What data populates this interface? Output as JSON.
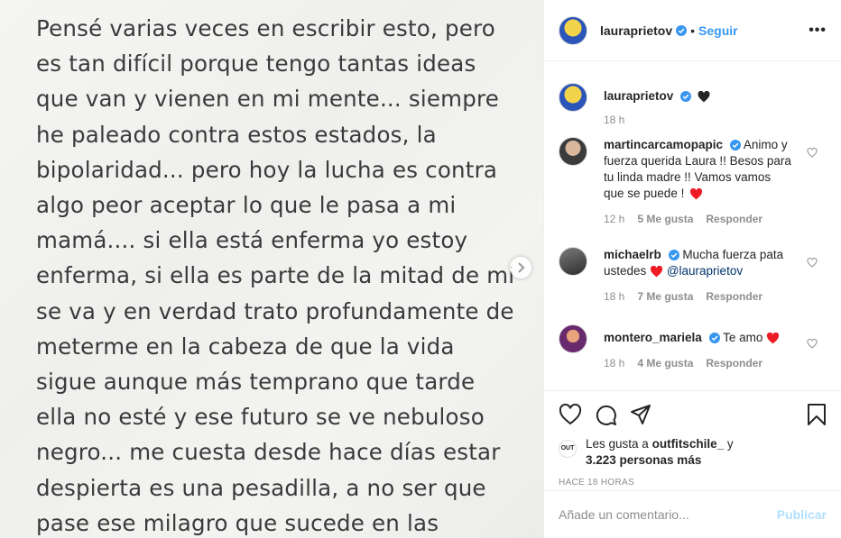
{
  "post_image": {
    "text": "Pensé varias veces en escribir esto, pero\nes tan difícil porque tengo tantas ideas\nque van y vienen en mi mente... siempre\nhe paleado contra estos estados, la\nbipolaridad... pero hoy la lucha es contra\nalgo peor aceptar lo que le pasa a mi\nmamá.... si ella está enferma yo estoy\nenferma, si ella es parte de la mitad de mi\nse va y en verdad trato profundamente de\nmeterme en la cabeza de que la vida\nsigue aunque más temprano que tarde\nella no esté y ese futuro se ve nebuloso\nnegro... me cuesta desde hace días estar\ndespierta es una pesadilla, a no ser que\npase ese milagro que sucede en las"
  },
  "header": {
    "username": "lauraprietov",
    "separator": "•",
    "follow_label": "Seguir",
    "more_label": "•••"
  },
  "caption": {
    "username": "lauraprietov",
    "time": "18 h"
  },
  "comments": [
    {
      "username": "martincarcamopapic",
      "text": "Animo y fuerza querida Laura !! Besos para tu linda madre !! Vamos vamos que se puede !",
      "time": "12 h",
      "likes": "5 Me gusta",
      "reply": "Responder"
    },
    {
      "username": "michaelrb",
      "text": "Mucha fuerza pata ustedes",
      "mention": "@lauraprietov",
      "time": "18 h",
      "likes": "7 Me gusta",
      "reply": "Responder"
    },
    {
      "username": "montero_mariela",
      "text": "Te amo",
      "time": "18 h",
      "likes": "4 Me gusta",
      "reply": "Responder"
    }
  ],
  "likes": {
    "prefix": "Les gusta a",
    "user": "outfitschile_",
    "joiner": "y",
    "others": "3.223 personas más",
    "liker_avatar_text": "OUT"
  },
  "timestamp": "HACE 18 HORAS",
  "add_comment": {
    "placeholder": "Añade un comentario...",
    "publish_label": "Publicar"
  },
  "colors": {
    "link_blue": "#3897f0",
    "verified_blue": "#3897f0",
    "heart_red": "#ed4956",
    "publish_disabled": "#b2dffc"
  }
}
